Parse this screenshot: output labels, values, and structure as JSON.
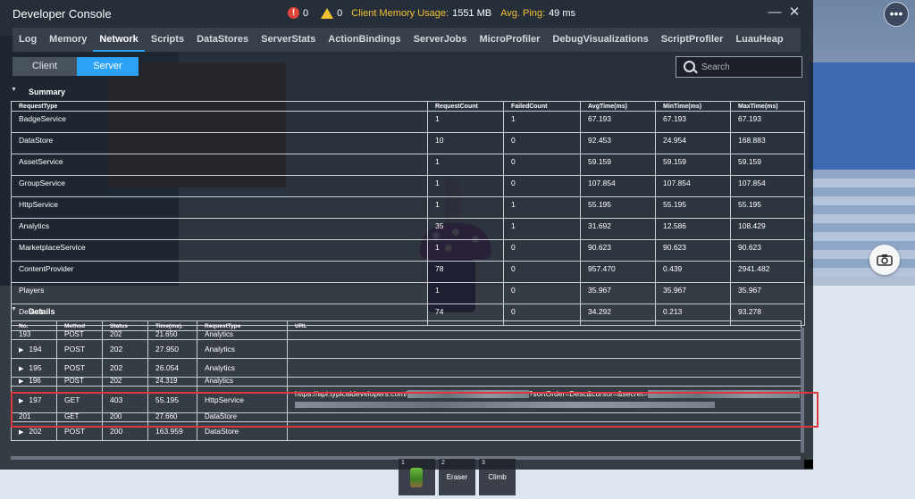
{
  "console": {
    "title": "Developer Console",
    "error_count": "0",
    "warning_count": "0",
    "memory_label": "Client Memory Usage:",
    "memory_value": "1551 MB",
    "ping_label": "Avg. Ping:",
    "ping_value": "49 ms",
    "minimize_glyph": "—",
    "close_glyph": "✕"
  },
  "tabs": [
    {
      "label": "Log"
    },
    {
      "label": "Memory"
    },
    {
      "label": "Network",
      "active": true
    },
    {
      "label": "Scripts"
    },
    {
      "label": "DataStores"
    },
    {
      "label": "ServerStats"
    },
    {
      "label": "ActionBindings"
    },
    {
      "label": "ServerJobs"
    },
    {
      "label": "MicroProfiler"
    },
    {
      "label": "DebugVisualizations"
    },
    {
      "label": "ScriptProfiler"
    },
    {
      "label": "LuauHeap"
    }
  ],
  "segments": {
    "client": "Client",
    "server": "Server",
    "selected": "Server"
  },
  "search": {
    "placeholder": "Search",
    "value": ""
  },
  "summary": {
    "title": "Summary",
    "columns": [
      "RequestType",
      "RequestCount",
      "FailedCount",
      "AvgTime(ms)",
      "MinTime(ms)",
      "MaxTime(ms)"
    ],
    "rows": [
      [
        "BadgeService",
        "1",
        "1",
        "67.193",
        "67.193",
        "67.193"
      ],
      [
        "DataStore",
        "10",
        "0",
        "92.453",
        "24.954",
        "168.883"
      ],
      [
        "AssetService",
        "1",
        "0",
        "59.159",
        "59.159",
        "59.159"
      ],
      [
        "GroupService",
        "1",
        "0",
        "107.854",
        "107.854",
        "107.854"
      ],
      [
        "HttpService",
        "1",
        "1",
        "55.195",
        "55.195",
        "55.195"
      ],
      [
        "Analytics",
        "35",
        "1",
        "31.692",
        "12.586",
        "108.429"
      ],
      [
        "MarketplaceService",
        "1",
        "0",
        "90.623",
        "90.623",
        "90.623"
      ],
      [
        "ContentProvider",
        "78",
        "0",
        "957.470",
        "0.439",
        "2941.482"
      ],
      [
        "Players",
        "1",
        "0",
        "35.967",
        "35.967",
        "35.967"
      ],
      [
        "Default",
        "74",
        "0",
        "34.292",
        "0.213",
        "93.278"
      ]
    ]
  },
  "details": {
    "title": "Details",
    "columns": [
      "No.",
      "Method",
      "Status",
      "Time(ms).",
      "RequestType",
      "URL"
    ],
    "partial_top": [
      "193",
      "POST",
      "202",
      "21.650",
      "Analytics",
      ""
    ],
    "rows": [
      [
        "194",
        "POST",
        "202",
        "27.950",
        "Analytics",
        ""
      ],
      [
        "195",
        "POST",
        "202",
        "26.054",
        "Analytics",
        ""
      ]
    ],
    "partial_mid": [
      "196",
      "POST",
      "202",
      "24.319",
      "Analytics",
      ""
    ],
    "highlight_row": {
      "no": "197",
      "method": "GET",
      "status": "403",
      "time": "55.195",
      "type": "HttpService",
      "url_prefix": "https://api.typicaldevelopers.com/",
      "url_mid": "?sortOrder=Desc&cursor=&secret="
    },
    "overlap_row": [
      "201",
      "GET",
      "200",
      "27.660",
      "DataStore",
      ""
    ],
    "last_row": [
      "202",
      "POST",
      "200",
      "163.959",
      "DataStore",
      ""
    ]
  },
  "hotbar": [
    {
      "num": "1",
      "label": ""
    },
    {
      "num": "2",
      "label": "Eraser"
    },
    {
      "num": "3",
      "label": "Climb"
    }
  ],
  "colors": {
    "accent": "#2ba2f5",
    "highlight": "#d9393f",
    "error": "#e0453a",
    "warning": "#f1c232"
  }
}
